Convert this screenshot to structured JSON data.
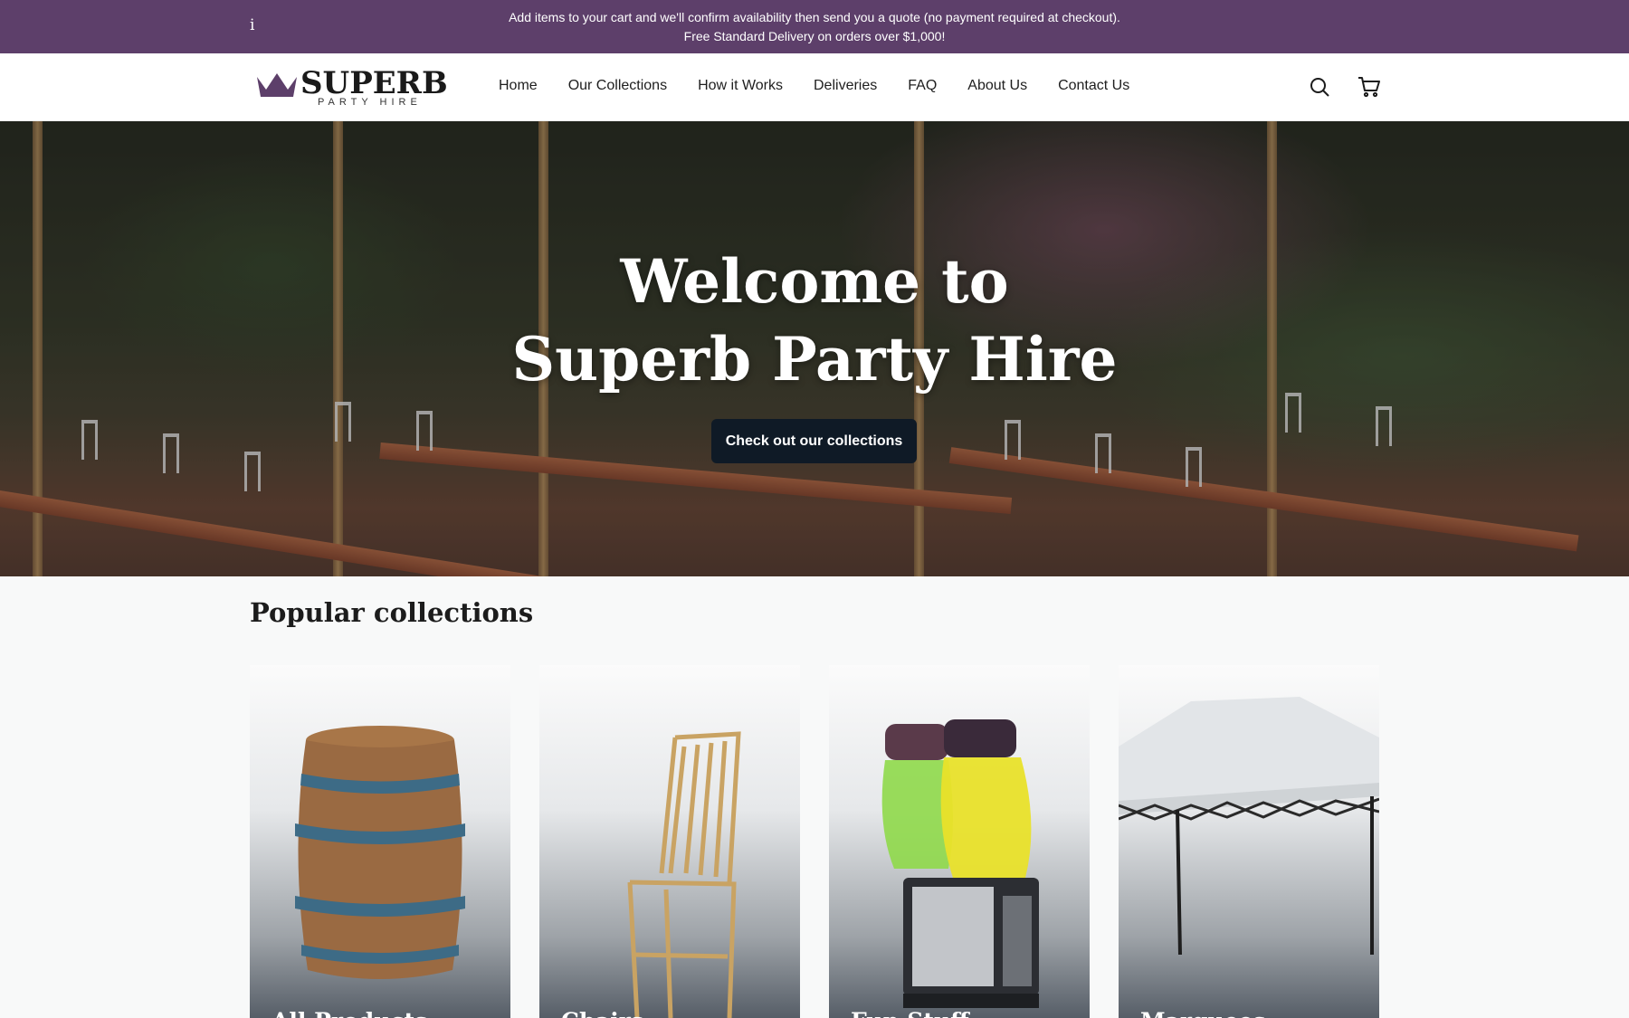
{
  "announcement": {
    "info_icon": "i",
    "line1": "Add items to your cart and we'll confirm availability then send you a quote (no payment required at checkout).",
    "line2": "Free Standard Delivery on orders over $1,000!",
    "bg_color": "#5d3f6a"
  },
  "header": {
    "logo_word": "SUPERB",
    "logo_sub": "PARTY HIRE",
    "crown_color": "#5d3f6a",
    "nav": [
      "Home",
      "Our Collections",
      "How it Works",
      "Deliveries",
      "FAQ",
      "About Us",
      "Contact Us"
    ],
    "icons": [
      "search-icon",
      "cart-icon"
    ]
  },
  "hero": {
    "title_line1": "Welcome to",
    "title_line2": "Superb Party Hire",
    "cta": "Check out our collections",
    "cta_color": "#0f1a26"
  },
  "collections": {
    "title": "Popular collections",
    "items": [
      "All Products",
      "Chairs",
      "Fun Stuff",
      "Marquees"
    ]
  }
}
